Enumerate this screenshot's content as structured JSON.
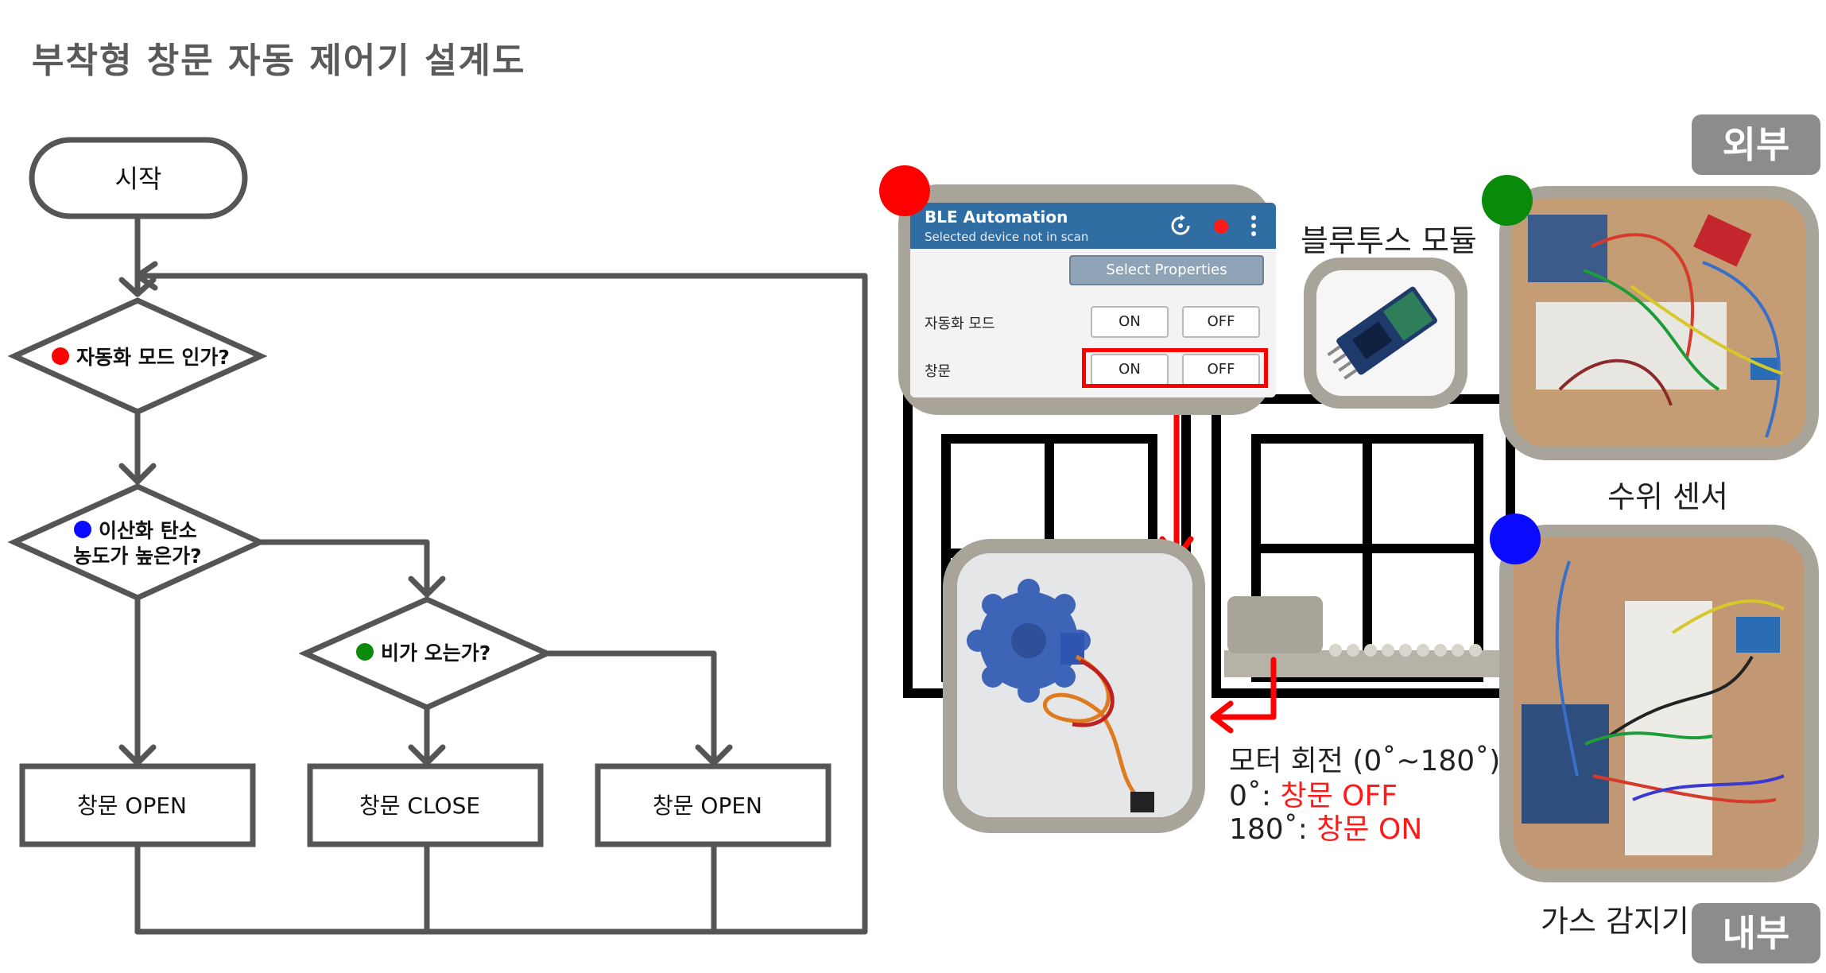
{
  "page": {
    "title": "부착형 창문 자동 제어기 설계도"
  },
  "flowchart": {
    "start": "시작",
    "decision_auto": "자동화 모드 인가?",
    "decision_co2_line1": "이산화 탄소",
    "decision_co2_line2": "농도가 높은가?",
    "decision_rain": "비가 오는가?",
    "result_left": "창문 OPEN",
    "result_middle": "창문 CLOSE",
    "result_right": "창문 OPEN"
  },
  "colors": {
    "red_dot": "#ff0000",
    "green_dot": "#0a8a0a",
    "blue_dot": "#0a0aff",
    "line": "#555555"
  },
  "app": {
    "title": "BLE Automation",
    "subtitle": "Selected device not in scan",
    "select_properties": "Select Properties",
    "row1_label": "자동화 모드",
    "row2_label": "창문",
    "on": "ON",
    "off": "OFF",
    "icons": [
      "refresh-icon",
      "record-icon",
      "more-vert-icon"
    ]
  },
  "labels": {
    "bluetooth_module": "블루투스 모듈",
    "water_sensor": "수위 센서",
    "gas_sensor": "가스 감지기",
    "outside": "외부",
    "inside": "내부",
    "motor_line1": "모터 회전 (0˚~180˚)",
    "motor_line2_prefix": "0˚: ",
    "motor_line2_value": "창문 OFF",
    "motor_line3_prefix": "180˚: ",
    "motor_line3_value": "창문 ON"
  }
}
